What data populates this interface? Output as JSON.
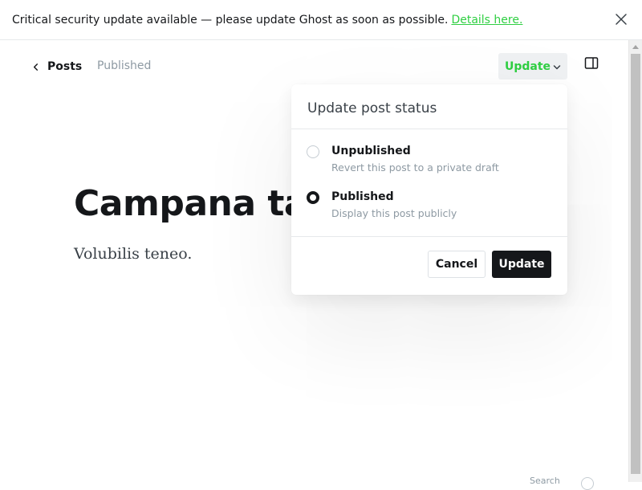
{
  "banner": {
    "message": "Critical security update available — please update Ghost as soon as possible.",
    "link_text": "Details here."
  },
  "header": {
    "back_label": "Posts",
    "status": "Published",
    "update_trigger_label": "Update"
  },
  "post": {
    "title": "Campana tabella",
    "body": "Volubilis teneo."
  },
  "popover": {
    "title": "Update post status",
    "options": [
      {
        "label": "Unpublished",
        "description": "Revert this post to a private draft",
        "selected": false
      },
      {
        "label": "Published",
        "description": "Display this post publicly",
        "selected": true
      }
    ],
    "cancel_label": "Cancel",
    "update_label": "Update"
  },
  "footer": {
    "hint": "Search"
  },
  "colors": {
    "accent_green": "#30cf43",
    "dark": "#15171a",
    "muted": "#8e9aa3"
  },
  "icons": [
    "close-icon",
    "chevron-left-icon",
    "chevron-down-icon",
    "sidebar-toggle-icon",
    "help-icon"
  ]
}
